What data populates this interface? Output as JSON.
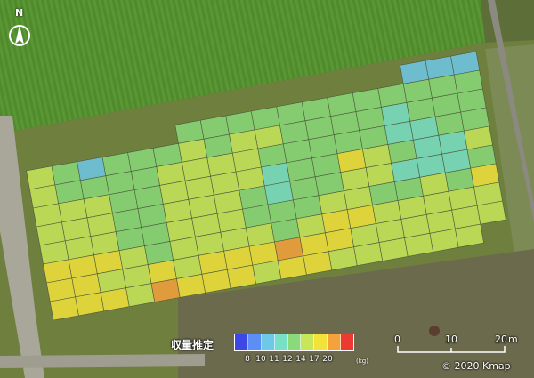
{
  "map": {
    "north_label": "N",
    "legend": {
      "title": "収量推定",
      "ticks": [
        "8",
        "10",
        "11",
        "12",
        "14",
        "17",
        "20"
      ],
      "unit": "(kg)",
      "colors": [
        "#3d47e6",
        "#5b8ff5",
        "#6ec8e8",
        "#78e0c4",
        "#8ad97a",
        "#c8e65a",
        "#f2e23a",
        "#f5a13c",
        "#ec3a32"
      ]
    },
    "scale": {
      "labels": [
        "0",
        "10",
        "20",
        "m"
      ]
    },
    "copyright": "© 2020 Kmap",
    "grid": {
      "rows": 9,
      "cols": 18,
      "cells": [
        [
          -1,
          -1,
          -1,
          -1,
          -1,
          -1,
          -1,
          -1,
          -1,
          -1,
          -1,
          -1,
          -1,
          -1,
          -1,
          2,
          2,
          2
        ],
        [
          -1,
          -1,
          -1,
          -1,
          -1,
          -1,
          4,
          4,
          4,
          4,
          4,
          4,
          4,
          4,
          4,
          4,
          4,
          4
        ],
        [
          5,
          4,
          2,
          4,
          4,
          4,
          5,
          4,
          5,
          5,
          4,
          4,
          4,
          4,
          3,
          4,
          4,
          4
        ],
        [
          5,
          4,
          4,
          4,
          4,
          5,
          5,
          5,
          5,
          4,
          4,
          4,
          4,
          4,
          3,
          3,
          4,
          4
        ],
        [
          5,
          5,
          5,
          4,
          4,
          5,
          5,
          5,
          5,
          3,
          4,
          4,
          6,
          5,
          4,
          3,
          3,
          5
        ],
        [
          5,
          5,
          5,
          4,
          4,
          5,
          5,
          5,
          4,
          3,
          4,
          4,
          5,
          5,
          3,
          3,
          3,
          4
        ],
        [
          5,
          5,
          5,
          4,
          4,
          5,
          5,
          5,
          4,
          4,
          4,
          5,
          5,
          4,
          4,
          5,
          4,
          6
        ],
        [
          6,
          6,
          6,
          5,
          4,
          5,
          5,
          5,
          5,
          4,
          5,
          6,
          6,
          5,
          5,
          5,
          5,
          5
        ],
        [
          6,
          6,
          5,
          5,
          6,
          5,
          6,
          6,
          6,
          7,
          6,
          6,
          5,
          5,
          5,
          5,
          5,
          5
        ],
        [
          6,
          6,
          6,
          5,
          7,
          6,
          6,
          6,
          5,
          6,
          6,
          5,
          5,
          5,
          5,
          5,
          5,
          -1
        ]
      ]
    }
  }
}
